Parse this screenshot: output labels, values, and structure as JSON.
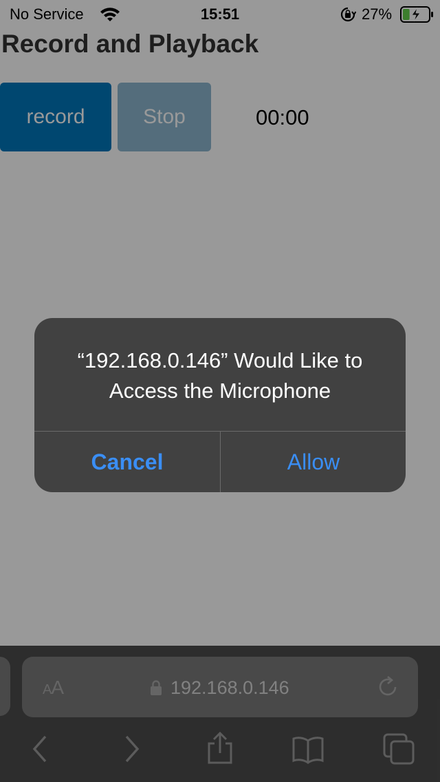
{
  "status_bar": {
    "carrier": "No Service",
    "time": "15:51",
    "battery_percent": "27%",
    "battery_level": 0.27,
    "battery_color": "#65d34b"
  },
  "page": {
    "title": "Record and Playback",
    "record_label": "record",
    "stop_label": "Stop",
    "timer": "00:00"
  },
  "alert": {
    "title": "“192.168.0.146” Would Like to Access the Microphone",
    "cancel_label": "Cancel",
    "allow_label": "Allow",
    "button_color": "#3a8ef5"
  },
  "safari": {
    "text_size_label_small": "A",
    "text_size_label_large": "A",
    "url": "192.168.0.146"
  },
  "icons": [
    "wifi-icon",
    "orientation-lock-icon",
    "battery-charging-icon",
    "padlock-icon",
    "reload-icon",
    "back-chevron-icon",
    "forward-chevron-icon",
    "share-icon",
    "bookmarks-icon",
    "tabs-icon"
  ]
}
